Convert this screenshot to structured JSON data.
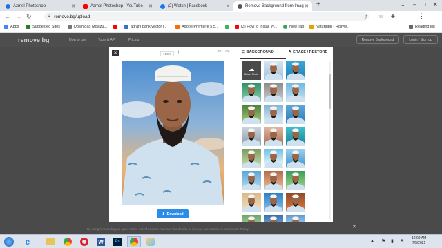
{
  "tabs": [
    {
      "title": "Azmol Photoshop",
      "color": "#1a73e8"
    },
    {
      "title": "Azmol Photoshop - YouTube",
      "color": "#ff0000"
    },
    {
      "title": "(2) Watch | Facebook",
      "color": "#1877f2"
    },
    {
      "title": "Remove Background from Imag",
      "color": "#555555"
    }
  ],
  "new_tab": "+",
  "omnibox": {
    "url": "remove.bg/upload"
  },
  "bookmarks": [
    {
      "label": "Apps",
      "icon": "apps-icon",
      "color": "#4285f4"
    },
    {
      "label": "Suggested Sites",
      "icon": "ie-icon",
      "color": "#2a7a2a"
    },
    {
      "label": "Download Movizu...",
      "icon": "bookmark-icon",
      "color": "#777777"
    },
    {
      "label": "",
      "icon": "youtube-icon",
      "color": "#ff0000"
    },
    {
      "label": "agrani bank vector l...",
      "icon": "bookmark-icon",
      "color": "#3b6fc6"
    },
    {
      "label": "Adobe Premiere 5.5...",
      "icon": "adobe-icon",
      "color": "#ff6a00"
    },
    {
      "label": "",
      "icon": "bookmark-icon",
      "color": "#3bb55c"
    },
    {
      "label": "(3) How to Install W...",
      "icon": "youtube-icon",
      "color": "#ff0000"
    },
    {
      "label": "New Tab",
      "icon": "chrome-icon",
      "color": "#34a853"
    },
    {
      "label": "Naturalbd - Hollyw...",
      "icon": "bookmark-icon",
      "color": "#e8a000"
    }
  ],
  "reading_list": "Reading list",
  "site": {
    "logo": "remove bg",
    "nav": [
      "How to use",
      "Tools & API",
      "Pricing"
    ],
    "remove_bg_button": "Remove Background",
    "login_button": "Login / Sign up"
  },
  "editor": {
    "zoom": "100%",
    "download": "Download",
    "tab_background": "BACKGROUND",
    "tab_erase": "ERASE / RESTORE",
    "select_photo": "Select Photo"
  },
  "cookie_bar": "By using remove.bg you agree to the use of cookies. You can find details on how we use cookies in our Cookie Policy.",
  "taskbar": {
    "time": "12:09 AM",
    "date": "7/5/2021"
  },
  "colors": {
    "accent": "#2b8de9",
    "page_bg": "#4a4a4a"
  }
}
